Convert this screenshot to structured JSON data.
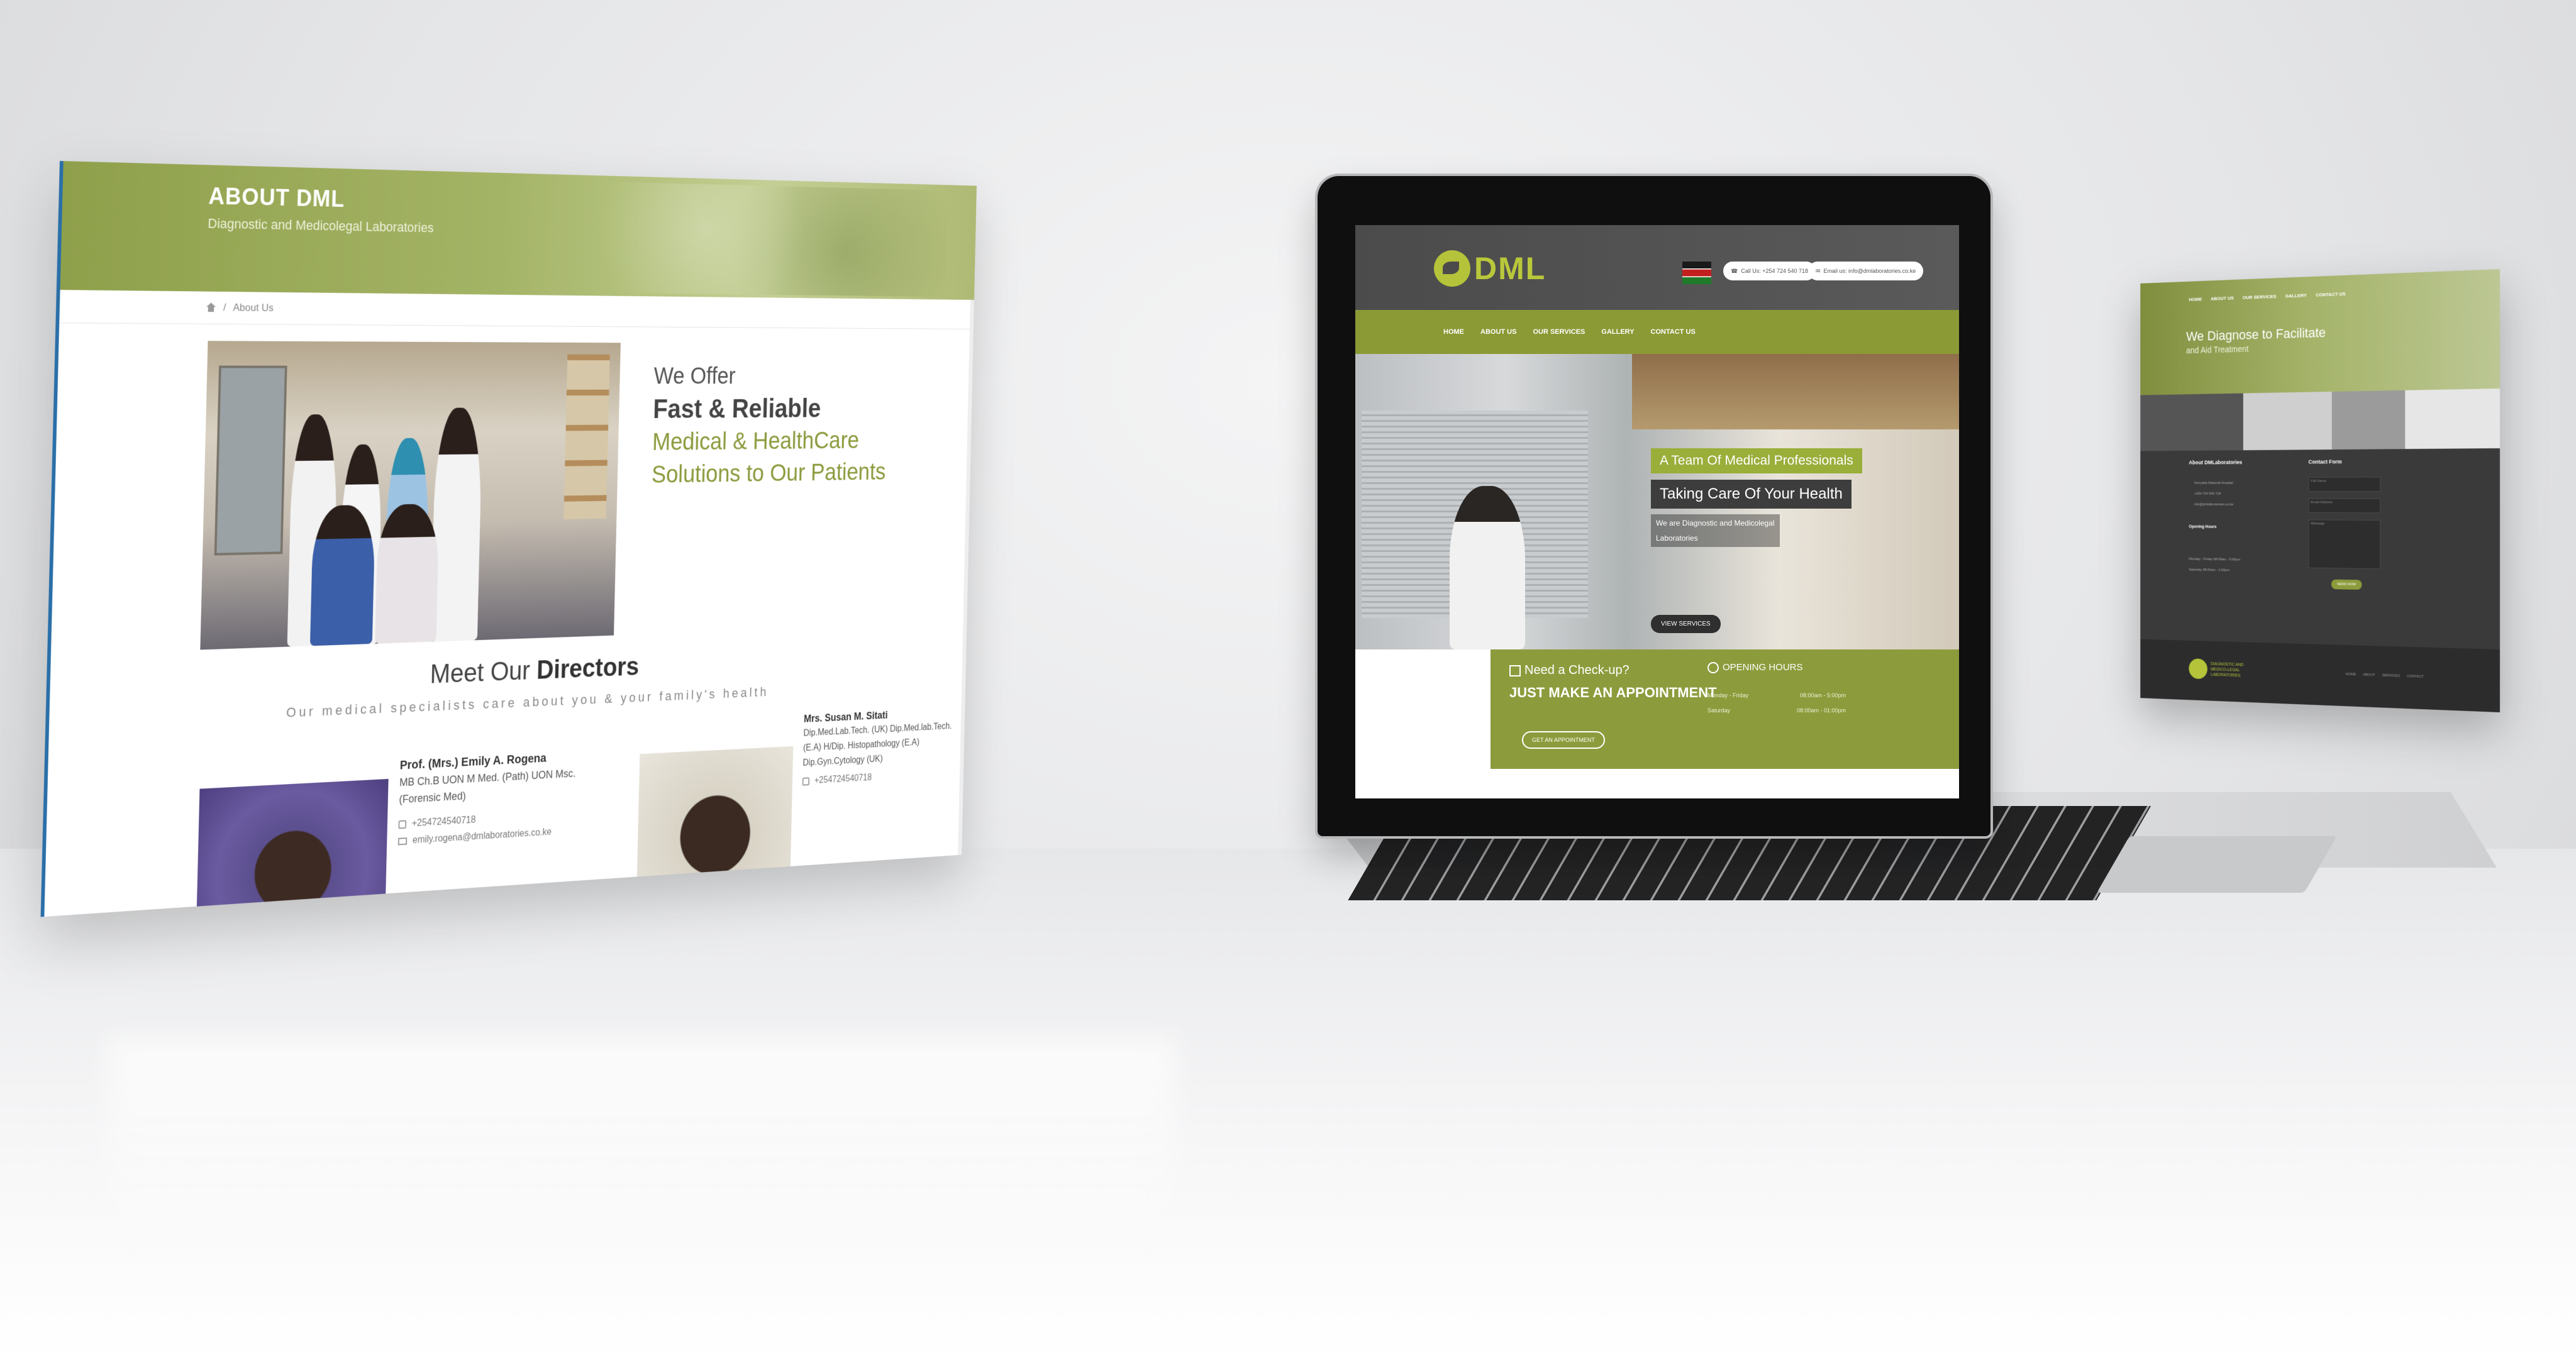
{
  "left_page": {
    "banner": {
      "title": "ABOUT DML",
      "subtitle": "Diagnostic and Medicolegal Laboratories"
    },
    "breadcrumb": {
      "current": "About Us"
    },
    "offer": {
      "line1": "We Offer",
      "line2": "Fast & Reliable",
      "line3": "Medical & HealthCare",
      "line4": "Solutions to Our Patients"
    },
    "directors_heading": {
      "prefix": "Meet Our",
      "bold": "Directors"
    },
    "directors_sub": "Our medical specialists care about you & your family's health",
    "director1": {
      "name": "Prof. (Mrs.) Emily A. Rogena",
      "cred1": "MB Ch.B UON M Med. (Path) UON Msc.",
      "cred2": "(Forensic Med)",
      "phone": "+254724540718",
      "email": "emily.rogena@dmlaboratories.co.ke"
    },
    "director2": {
      "name": "Mrs. Susan M. Sitati",
      "cred1": "Dip.Med.Lab.Tech. (UK) Dip.Med.lab.Tech.",
      "cred2": "(E.A) H/Dip. Histopathology (E.A)",
      "cred3": "Dip.Gyn.Cytology (UK)",
      "phone": "+254724540718"
    }
  },
  "laptop_page": {
    "logo": "DML",
    "contact_phone": "Call Us: +254 724 540 718",
    "contact_email": "Email us: info@dmlaboratories.co.ke",
    "nav": [
      "HOME",
      "ABOUT US",
      "OUR SERVICES",
      "GALLERY",
      "CONTACT US"
    ],
    "hero": {
      "tag1": "A Team Of Medical Professionals",
      "tag2": "Taking Care Of Your Health",
      "small1": "We are Diagnostic and Medicolegal",
      "small2": "Laboratories",
      "button": "VIEW SERVICES"
    },
    "cta": {
      "need": "Need a Check-up?",
      "make": "JUST MAKE AN APPOINTMENT",
      "button": "GET AN APPOINTMENT",
      "hours_title": "OPENING HOURS",
      "hours": [
        {
          "day": "Monday - Friday",
          "time": "08:00am - 5:00pm"
        },
        {
          "day": "Saturday",
          "time": "08:00am - 01:00pm"
        }
      ]
    }
  },
  "right_page": {
    "nav": [
      "HOME",
      "ABOUT US",
      "OUR SERVICES",
      "GALLERY",
      "CONTACT US"
    ],
    "heading": "We Diagnose to Facilitate",
    "subheading": "and Aid Treatment",
    "about_title": "About DMLaboratories",
    "contact_title": "Contact Form",
    "hours_title": "Opening Hours",
    "contact_lines": [
      "Kenyatta National Hospital",
      "+254 724 540 718",
      "info@dmlaboratories.co.ke"
    ],
    "hours_lines": [
      "Monday - Friday  08:00am - 5:00pm",
      "Saturday  08:00am - 1:00pm"
    ],
    "form_placeholders": [
      "Full Name",
      "Email Address",
      "Message"
    ],
    "send_button": "SEND NOW",
    "footer_logo": "DIAGNOSTIC AND MEDICO-LEGAL LABORATORIES",
    "footer_links": [
      "HOME",
      "ABOUT",
      "SERVICES",
      "CONTACT"
    ]
  },
  "colors": {
    "brand_green": "#8c9c3c",
    "dark_header": "#4b4b4b",
    "logo_green": "#b9c83a"
  }
}
